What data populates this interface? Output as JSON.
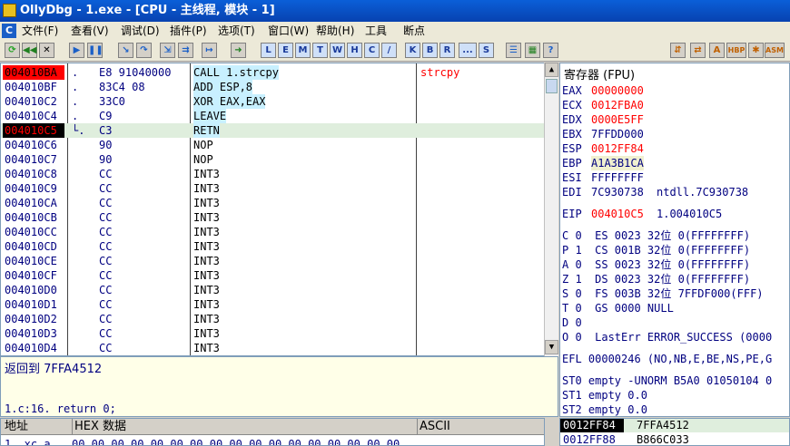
{
  "window": {
    "title": "OllyDbg - 1.exe - [CPU -  主线程, 模块 - 1]"
  },
  "menu": [
    "文件(F)",
    "查看(V)",
    "调试(D)",
    "插件(P)",
    "选项(T)",
    "窗口(W)",
    "帮助(H)",
    "工具",
    "断点"
  ],
  "toolbar": {
    "letters": [
      "L",
      "E",
      "M",
      "T",
      "W",
      "H",
      "C",
      "/",
      "K",
      "B",
      "R",
      "...",
      "S"
    ],
    "right": [
      "HBP",
      "ASM"
    ]
  },
  "disasm": {
    "rows": [
      {
        "addr": "004010BA",
        "mark": ".",
        "hex": "E8 91040000",
        "asm": "CALL 1.strcpy",
        "comment": "strcpy"
      },
      {
        "addr": "004010BF",
        "mark": ".",
        "hex": "83C4 08",
        "asm": "ADD ESP,8",
        "comment": ""
      },
      {
        "addr": "004010C2",
        "mark": ".",
        "hex": "33C0",
        "asm": "XOR EAX,EAX",
        "comment": ""
      },
      {
        "addr": "004010C4",
        "mark": ".",
        "hex": "C9",
        "asm": "LEAVE",
        "comment": ""
      },
      {
        "addr": "004010C5",
        "mark": "└.",
        "hex": "C3",
        "asm": "RETN",
        "comment": ""
      },
      {
        "addr": "004010C6",
        "mark": "",
        "hex": "90",
        "asm": "NOP",
        "comment": ""
      },
      {
        "addr": "004010C7",
        "mark": "",
        "hex": "90",
        "asm": "NOP",
        "comment": ""
      },
      {
        "addr": "004010C8",
        "mark": "",
        "hex": "CC",
        "asm": "INT3",
        "comment": ""
      },
      {
        "addr": "004010C9",
        "mark": "",
        "hex": "CC",
        "asm": "INT3",
        "comment": ""
      },
      {
        "addr": "004010CA",
        "mark": "",
        "hex": "CC",
        "asm": "INT3",
        "comment": ""
      },
      {
        "addr": "004010CB",
        "mark": "",
        "hex": "CC",
        "asm": "INT3",
        "comment": ""
      },
      {
        "addr": "004010CC",
        "mark": "",
        "hex": "CC",
        "asm": "INT3",
        "comment": ""
      },
      {
        "addr": "004010CD",
        "mark": "",
        "hex": "CC",
        "asm": "INT3",
        "comment": ""
      },
      {
        "addr": "004010CE",
        "mark": "",
        "hex": "CC",
        "asm": "INT3",
        "comment": ""
      },
      {
        "addr": "004010CF",
        "mark": "",
        "hex": "CC",
        "asm": "INT3",
        "comment": ""
      },
      {
        "addr": "004010D0",
        "mark": "",
        "hex": "CC",
        "asm": "INT3",
        "comment": ""
      },
      {
        "addr": "004010D1",
        "mark": "",
        "hex": "CC",
        "asm": "INT3",
        "comment": ""
      },
      {
        "addr": "004010D2",
        "mark": "",
        "hex": "CC",
        "asm": "INT3",
        "comment": ""
      },
      {
        "addr": "004010D3",
        "mark": "",
        "hex": "CC",
        "asm": "INT3",
        "comment": ""
      },
      {
        "addr": "004010D4",
        "mark": "",
        "hex": "CC",
        "asm": "INT3",
        "comment": ""
      }
    ]
  },
  "info": {
    "line1": "返回到 7FFA4512",
    "line2": "1.c:16.  return 0;"
  },
  "registers": {
    "title": "寄存器 (FPU)",
    "rows": [
      {
        "name": "EAX",
        "val": "00000000",
        "extra": ""
      },
      {
        "name": "ECX",
        "val": "0012FBA0",
        "extra": ""
      },
      {
        "name": "EDX",
        "val": "0000E5FF",
        "extra": ""
      },
      {
        "name": "EBX",
        "val": "7FFDD000",
        "extra": ""
      },
      {
        "name": "ESP",
        "val": "0012FF84",
        "extra": ""
      },
      {
        "name": "EBP",
        "val": "A1A3B1CA",
        "extra": ""
      },
      {
        "name": "ESI",
        "val": "FFFFFFFF",
        "extra": ""
      },
      {
        "name": "EDI",
        "val": "7C930738",
        "extra": "ntdll.7C930738"
      }
    ],
    "eip": {
      "name": "EIP",
      "val": "004010C5",
      "extra": "1.004010C5"
    },
    "flags": [
      "C 0  ES 0023 32位 0(FFFFFFFF)",
      "P 1  CS 001B 32位 0(FFFFFFFF)",
      "A 0  SS 0023 32位 0(FFFFFFFF)",
      "Z 1  DS 0023 32位 0(FFFFFFFF)",
      "S 0  FS 003B 32位 7FFDF000(FFF)",
      "T 0  GS 0000 NULL",
      "D 0",
      "O 0  LastErr ERROR_SUCCESS (0000"
    ],
    "efl": "EFL 00000246 (NO,NB,E,BE,NS,PE,G",
    "fpu": [
      "ST0 empty -UNORM B5A0 01050104 0",
      "ST1 empty 0.0",
      "ST2 empty 0.0"
    ]
  },
  "dump": {
    "h_addr": "地址",
    "h_hex": "HEX 数据",
    "h_ascii": "ASCII",
    "row_addr": "1._xc_a",
    "row_hex": "00 00 00 00 00 00 00 00 00 00 00 00 00 00 00 00 00"
  },
  "stack": [
    {
      "addr": "0012FF84",
      "val": "7FFA4512"
    },
    {
      "addr": "0012FF88",
      "val": "B866C033"
    }
  ],
  "colors": {
    "sel": "#dfeedd",
    "red": "#ff0000",
    "addr": "#000080"
  }
}
